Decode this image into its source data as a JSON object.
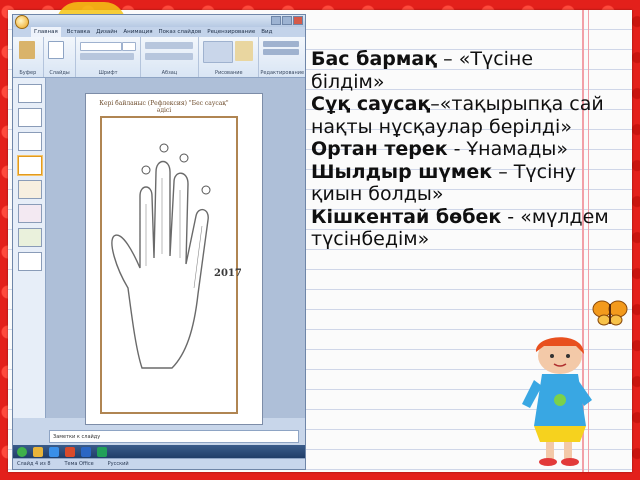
{
  "app": {
    "tabs": [
      "Главная",
      "Вставка",
      "Дизайн",
      "Анимация",
      "Показ слайдов",
      "Рецензирование",
      "Вид"
    ],
    "ribbon_groups": [
      "Буфер",
      "Слайды",
      "Шрифт",
      "Абзац",
      "Рисование",
      "Редактирование"
    ],
    "slide_title": "Кері байланыс (Рефлексия) \"Бес саусақ\" әдісі",
    "slide_year": "2017",
    "notes_placeholder": "Заметки к слайду",
    "status": [
      "Слайд 4 из 8",
      "Тема Office",
      "Русский"
    ]
  },
  "reflection": [
    {
      "label": "Бас бармақ",
      "sep": " – ",
      "text": "«Түсіне білдім»"
    },
    {
      "label": "Сұқ саусақ",
      "sep": "–",
      "text": "«тақырыпқа сай нақты нұсқаулар берілді»"
    },
    {
      "label": "Ортан терек",
      "sep": " - ",
      "text": "Ұнамады»"
    },
    {
      "label": "Шылдыр шүмек",
      "sep": " – ",
      "text": "Түсіну қиын болды»"
    },
    {
      "label": "Кішкентай бөбек",
      "sep": " - ",
      "text": "«мүлдем түсінбедім»"
    }
  ],
  "colors": {
    "frame": "#e3201b",
    "paper": "#fbfbfb",
    "lines": "#cfd6e8",
    "accent": "#f5c414"
  }
}
